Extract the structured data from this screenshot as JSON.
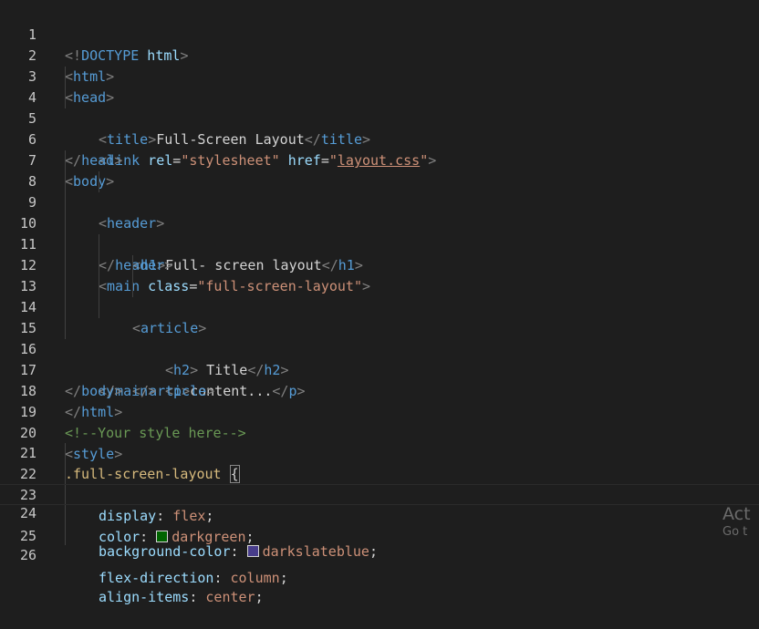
{
  "lines": [
    {
      "n": "1"
    },
    {
      "n": "2"
    },
    {
      "n": "3"
    },
    {
      "n": "4"
    },
    {
      "n": "5"
    },
    {
      "n": "6"
    },
    {
      "n": "7"
    },
    {
      "n": "8"
    },
    {
      "n": "9"
    },
    {
      "n": "10"
    },
    {
      "n": "11"
    },
    {
      "n": "12"
    },
    {
      "n": "13"
    },
    {
      "n": "14"
    },
    {
      "n": "15"
    },
    {
      "n": "16"
    },
    {
      "n": "17"
    },
    {
      "n": "18"
    },
    {
      "n": "19"
    },
    {
      "n": "20"
    },
    {
      "n": "21"
    },
    {
      "n": "22"
    },
    {
      "n": "23"
    },
    {
      "n": "24"
    },
    {
      "n": "25"
    },
    {
      "n": "26"
    }
  ],
  "code": {
    "l1": {
      "a": "<!",
      "b": "DOCTYPE",
      "c": " html",
      "d": ">"
    },
    "l2": {
      "a": "<",
      "b": "html",
      "c": ">"
    },
    "l3": {
      "a": "<",
      "b": "head",
      "c": ">"
    },
    "l4": {
      "a": "<",
      "b": "title",
      "c": ">",
      "t": "Full-Screen Layout",
      "d": "</",
      "e": "title",
      "f": ">"
    },
    "l5": {
      "a": "<",
      "b": "link",
      "c": " rel",
      "d": "=",
      "e": "\"stylesheet\"",
      "f": " href",
      "g": "=",
      "h": "\"",
      "i": "layout.css",
      "j": "\"",
      "k": ">"
    },
    "l6": {
      "a": "</",
      "b": "head",
      "c": ">"
    },
    "l7": {
      "a": "<",
      "b": "body",
      "c": ">"
    },
    "l8": {
      "a": "<",
      "b": "header",
      "c": ">"
    },
    "l9": {
      "a": "<",
      "b": "h1",
      "c": ">",
      "t": "Full- screen layout",
      "d": "</",
      "e": "h1",
      "f": ">"
    },
    "l10": {
      "a": "</",
      "b": "header",
      "c": ">"
    },
    "l11": {
      "a": "<",
      "b": "main",
      "c": " class",
      "d": "=",
      "e": "\"full-screen-layout\"",
      "f": ">"
    },
    "l12": {
      "a": "<",
      "b": "article",
      "c": ">"
    },
    "l13": {
      "a": "<",
      "b": "h2",
      "c": ">",
      "t": " Title",
      "d": "</",
      "e": "h2",
      "f": ">"
    },
    "l14": {
      "a": "<",
      "b": "p",
      "c": ">",
      "t": "content...",
      "d": "</",
      "e": "p",
      "f": ">"
    },
    "l15": {
      "a": "</",
      "b": "article",
      "c": ">"
    },
    "l16": {
      "a": "</",
      "b": "main",
      "c": ">"
    },
    "l17": {
      "a": "</",
      "b": "body",
      "c": ">"
    },
    "l18": {
      "a": "</",
      "b": "html",
      "c": ">"
    },
    "l19": {
      "a": "<!--Your style here-->"
    },
    "l20": {
      "a": "<",
      "b": "style",
      "c": ">"
    },
    "l21": {
      "a": ".full-screen-layout",
      "b": " ",
      "c": "{"
    },
    "l22": {
      "a": "display",
      "b": ": ",
      "c": "flex",
      "d": ";"
    },
    "l23": {
      "a": "color",
      "b": ": ",
      "c": "darkgreen",
      "d": ";"
    },
    "l24": {
      "a": "background-color",
      "b": ": ",
      "c": "darkslateblue",
      "d": ";"
    },
    "l25": {
      "a": "flex-direction",
      "b": ": ",
      "c": "column",
      "d": ";"
    },
    "l26": {
      "a": "align-items",
      "b": ": ",
      "c": "center",
      "d": ";"
    }
  },
  "colors": {
    "darkgreen": "#006400",
    "darkslateblue": "#483d8b"
  },
  "watermark": {
    "line1": "Act",
    "line2": "Go t"
  }
}
